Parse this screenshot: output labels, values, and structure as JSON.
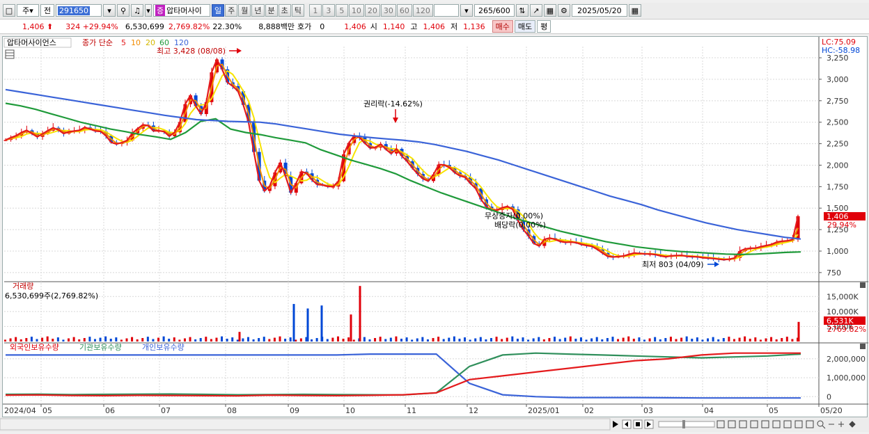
{
  "toolbar1": {
    "period_type": "주",
    "prev_label": "전",
    "code": "291650",
    "speaker_icon": "speaker-icon",
    "stock_name_badge": "증",
    "stock_name": "압타머사이",
    "periods": [
      "일",
      "주",
      "월",
      "년",
      "분",
      "초",
      "틱"
    ],
    "selected_period": "일",
    "nums": [
      "1",
      "3",
      "5",
      "10",
      "20",
      "30",
      "60",
      "120"
    ],
    "count": "265",
    "count_max": "/600",
    "date": "2025/05/20"
  },
  "quote": {
    "price": "1,406",
    "change": "324",
    "change_rate": "+29.94%",
    "volume": "6,530,699",
    "vol_rate": "2,769.82%",
    "turnover": "22.30%",
    "amount": "8,888백만",
    "hoga_label": "호가",
    "hoga": "0",
    "hoga_price": "1,406",
    "open_label": "시",
    "open": "1,140",
    "high_label": "고",
    "high": "1,406",
    "low_label": "저",
    "low": "1,136",
    "buy": "매수",
    "sell": "매도",
    "eval": "평"
  },
  "colors": {
    "up": "#e0000a",
    "down": "#0047d6",
    "ma5": "#e41a1c",
    "ma10": "#f28c00",
    "ma20": "#f7e300",
    "ma60": "#1f9a3a",
    "ma120": "#3a63d8",
    "foreign": "#e41a1c",
    "institution": "#2f8f5b",
    "individual": "#3a63d8"
  },
  "chart_data": {
    "type": "candlestick",
    "title": "압타머사이언스",
    "legend": [
      "종가 단순",
      "5",
      "10",
      "20",
      "60",
      "120"
    ],
    "x_ticks": [
      "2024/04",
      "05",
      "06",
      "07",
      "08",
      "09",
      "10",
      "11",
      "12",
      "2025/01",
      "02",
      "03",
      "04",
      "05",
      "05/20"
    ],
    "y_ticks": [
      "3,250",
      "3,000",
      "2,750",
      "2,500",
      "2,250",
      "2,000",
      "1,750",
      "1,500",
      "1,250",
      "1,000",
      "750"
    ],
    "ylim": [
      660,
      3380
    ],
    "lc_label": "LC:75.09",
    "hc_label": "HC:-58.98",
    "last_price": "1,406",
    "last_rate": "29.94%",
    "annotations": {
      "high": "최고 3,428 (08/08)",
      "ex_rights": "권리락(-14.62%)",
      "bonus": "무상증자(0.00%)",
      "dividend": "배당락(0.00%)",
      "low": "최저 803 (04/09)"
    },
    "close_series": [
      2294,
      2320,
      2344,
      2380,
      2405,
      2368,
      2330,
      2365,
      2402,
      2435,
      2410,
      2368,
      2389,
      2398,
      2406,
      2440,
      2420,
      2397,
      2392,
      2342,
      2265,
      2246,
      2263,
      2288,
      2372,
      2425,
      2470,
      2461,
      2398,
      2401,
      2390,
      2337,
      2383,
      2502,
      2710,
      2812,
      2688,
      2595,
      2734,
      3080,
      3230,
      3115,
      2964,
      2920,
      2860,
      2702,
      2498,
      2154,
      1820,
      1700,
      1755,
      1915,
      2029,
      1872,
      1680,
      1790,
      1925,
      1905,
      1830,
      1775,
      1770,
      1752,
      1752,
      1813,
      2125,
      2258,
      2345,
      2322,
      2256,
      2200,
      2205,
      2245,
      2184,
      2136,
      2189,
      2108,
      2045,
      1968,
      1898,
      1843,
      1815,
      1890,
      2007,
      2003,
      1972,
      1915,
      1876,
      1859,
      1788,
      1729,
      1602,
      1517,
      1473,
      1478,
      1504,
      1520,
      1485,
      1355,
      1252,
      1175,
      1089,
      1060,
      1137,
      1152,
      1136,
      1112,
      1101,
      1107,
      1097,
      1078,
      1065,
      1055,
      1020,
      977,
      938,
      931,
      937,
      943,
      962,
      978,
      972,
      966,
      967,
      959,
      944,
      934,
      945,
      948,
      950,
      938,
      935,
      933,
      922,
      918,
      913,
      905,
      900,
      906,
      920,
      1000,
      1025,
      1033,
      1035,
      1052,
      1065,
      1078,
      1105,
      1115,
      1120,
      1135,
      1406
    ],
    "ma5": [
      2294,
      2320,
      2344,
      2380,
      2405,
      2368,
      2330,
      2365,
      2402,
      2435,
      2410,
      2368,
      2389,
      2398,
      2406,
      2440,
      2420,
      2397,
      2392,
      2342,
      2265,
      2246,
      2263,
      2288,
      2372,
      2425,
      2470,
      2461,
      2398,
      2401,
      2390,
      2337,
      2383,
      2502,
      2710,
      2812,
      2688,
      2595,
      2734,
      3080,
      3230,
      3115,
      2964,
      2920,
      2860,
      2702,
      2498,
      2154,
      1820,
      1700,
      1755,
      1915,
      2029,
      1872,
      1680,
      1790,
      1925,
      1905,
      1830,
      1775,
      1770,
      1752,
      1752,
      1813,
      2125,
      2258,
      2345,
      2322,
      2256,
      2200,
      2205,
      2245,
      2184,
      2136,
      2189,
      2108,
      2045,
      1968,
      1898,
      1843,
      1815,
      1890,
      2007,
      2003,
      1972,
      1915,
      1876,
      1859,
      1788,
      1729,
      1602,
      1517,
      1473,
      1478,
      1504,
      1520,
      1485,
      1355,
      1252,
      1175,
      1089,
      1060,
      1137,
      1152,
      1136,
      1112,
      1101,
      1107,
      1097,
      1078,
      1065,
      1055,
      1020,
      977,
      938,
      931,
      937,
      943,
      962,
      978,
      972,
      966,
      967,
      959,
      944,
      934,
      945,
      948,
      950,
      938,
      935,
      933,
      922,
      918,
      913,
      905,
      900,
      906,
      920,
      1000,
      1025,
      1033,
      1035,
      1052,
      1065,
      1078,
      1105,
      1115,
      1120,
      1135,
      1406
    ],
    "ma60": [
      2720,
      2690,
      2650,
      2600,
      2550,
      2500,
      2460,
      2420,
      2390,
      2355,
      2330,
      2300,
      2380,
      2510,
      2540,
      2420,
      2380,
      2355,
      2320,
      2290,
      2260,
      2180,
      2120,
      2060,
      2010,
      1960,
      1900,
      1820,
      1750,
      1680,
      1620,
      1560,
      1500,
      1440,
      1380,
      1330,
      1280,
      1230,
      1190,
      1150,
      1110,
      1080,
      1050,
      1030,
      1010,
      995,
      985,
      975,
      965,
      960,
      965,
      975,
      985,
      990
    ],
    "ma120": [
      2880,
      2850,
      2820,
      2790,
      2760,
      2730,
      2700,
      2670,
      2640,
      2610,
      2580,
      2555,
      2530,
      2520,
      2510,
      2505,
      2500,
      2480,
      2450,
      2420,
      2390,
      2360,
      2340,
      2320,
      2305,
      2290,
      2270,
      2240,
      2200,
      2160,
      2110,
      2060,
      2000,
      1940,
      1880,
      1820,
      1760,
      1700,
      1640,
      1590,
      1540,
      1480,
      1430,
      1380,
      1330,
      1290,
      1250,
      1220,
      1190,
      1160,
      1140
    ],
    "volume": {
      "label": "거래량",
      "summary": "6,530,699주(2,769.82%)",
      "y_ticks": [
        "15,000K",
        "10,000K",
        "5,000K"
      ],
      "last_value": "6,531K",
      "last_rate": "2769.82%",
      "spikes": [
        [
          "2024-08-08",
          3200
        ],
        [
          "2024-09-02",
          12500
        ],
        [
          "2024-09-10",
          11000
        ],
        [
          "2024-09-20",
          12000
        ],
        [
          "2024-10-11",
          9000
        ],
        [
          "2024-10-14",
          18500
        ],
        [
          "2025-05-20",
          6531
        ]
      ]
    },
    "holdings": {
      "series_names": [
        "외국인보유수량",
        "기관보유수량",
        "개인보유수량"
      ],
      "y_ticks": [
        "2,000,000",
        "1,000,000",
        "0"
      ],
      "foreign": [
        80000,
        90000,
        60000,
        50000,
        70000,
        60000,
        50000,
        40000,
        80000,
        60000,
        50000,
        70000,
        100000,
        200000,
        900000,
        1100000,
        1300000,
        1500000,
        1700000,
        1900000,
        2000000,
        2200000,
        2300000,
        2300000,
        2300000
      ],
      "institution": [
        120000,
        130000,
        110000,
        120000,
        130000,
        140000,
        120000,
        100000,
        110000,
        120000,
        110000,
        100000,
        90000,
        200000,
        1600000,
        2200000,
        2300000,
        2250000,
        2200000,
        2150000,
        2100000,
        2050000,
        2100000,
        2150000,
        2250000
      ],
      "individual": [
        2200000,
        2200000,
        2200000,
        2200000,
        2200000,
        2200000,
        2200000,
        2200000,
        2200000,
        2200000,
        2200000,
        2250000,
        2250000,
        2250000,
        700000,
        100000,
        0,
        -50000,
        -50000,
        -50000,
        -60000,
        -70000,
        -70000,
        -70000,
        -70000
      ]
    }
  }
}
